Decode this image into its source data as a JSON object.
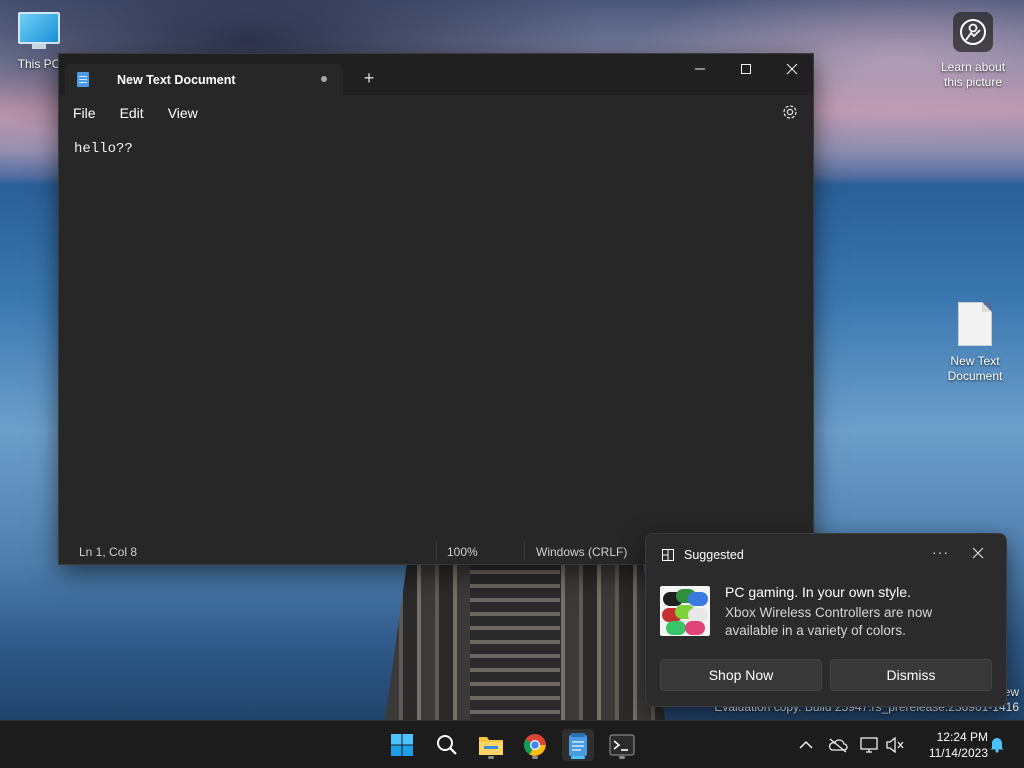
{
  "desktop": {
    "this_pc_label": "This PC",
    "learn_label_1": "Learn about",
    "learn_label_2": "this picture",
    "file_label_1": "New Text",
    "file_label_2": "Document",
    "watermark_line1": "ew",
    "watermark_line2": "Evaluation copy. Build 25947.rs_prerelease.230901-1416"
  },
  "notepad": {
    "tab_title": "New Text Document",
    "new_tab_symbol": "+",
    "menu": [
      "File",
      "Edit",
      "View"
    ],
    "content": "hello??",
    "status": {
      "position": "Ln 1, Col 8",
      "zoom": "100%",
      "line_ending": "Windows (CRLF)"
    }
  },
  "notification": {
    "app": "Suggested",
    "more": "···",
    "title": "PC gaming. In your own style.",
    "body": "Xbox Wireless Controllers are now available in a variety of colors.",
    "primary_button": "Shop Now",
    "secondary_button": "Dismiss"
  },
  "taskbar": {
    "time": "12:24 PM",
    "date": "11/14/2023",
    "icons": [
      "start-icon",
      "search-icon",
      "file-explorer-icon",
      "chrome-icon",
      "notepad-icon",
      "terminal-icon"
    ]
  },
  "colors": {
    "accent": "#4cc2ff",
    "window_bg": "#272727",
    "titlebar_bg": "#202020",
    "taskbar_bg": "#1c1c1c"
  }
}
